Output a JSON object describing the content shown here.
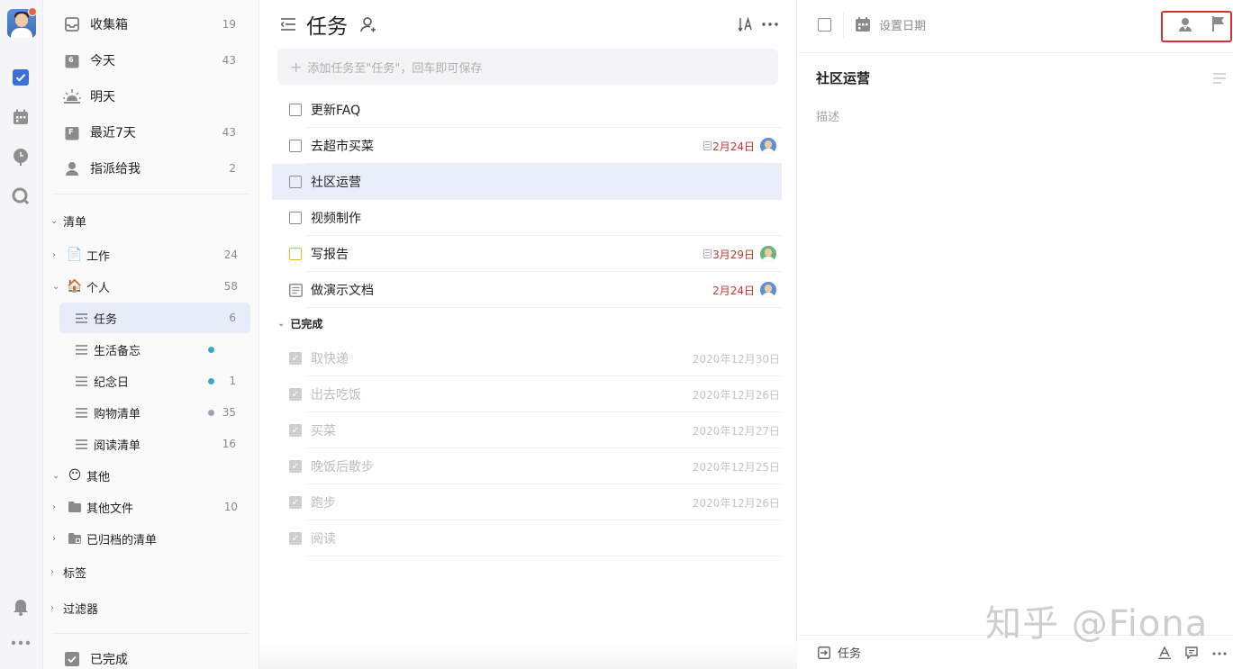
{
  "colors": {
    "accent": "#3b6fd8",
    "selected_bg": "#e9edf9",
    "date_red": "#c0392b",
    "highlight_box": "#d3302f"
  },
  "rail": {
    "items": [
      {
        "name": "tasks-icon"
      },
      {
        "name": "calendar-icon"
      },
      {
        "name": "pomodoro-icon"
      },
      {
        "name": "search-icon"
      },
      {
        "name": "bell-icon"
      },
      {
        "name": "more-icon"
      }
    ]
  },
  "smart_lists": [
    {
      "label": "收集箱",
      "count": "19",
      "icon": "inbox-icon"
    },
    {
      "label": "今天",
      "count": "43",
      "icon": "calendar-today-icon",
      "icon_text": "6"
    },
    {
      "label": "明天",
      "count": "",
      "icon": "sunrise-icon"
    },
    {
      "label": "最近7天",
      "count": "43",
      "icon": "calendar-week-icon",
      "icon_text": "F"
    },
    {
      "label": "指派给我",
      "count": "2",
      "icon": "assigned-icon"
    }
  ],
  "lists_section": {
    "label": "清单"
  },
  "folders": [
    {
      "label": "工作",
      "count": "24",
      "icon": "📄"
    },
    {
      "label": "个人",
      "count": "58",
      "icon": "🏠"
    }
  ],
  "personal_lists": [
    {
      "label": "任务",
      "count": "6",
      "dot": ""
    },
    {
      "label": "生活备忘",
      "count": "",
      "dot": "#3aa8c1"
    },
    {
      "label": "纪念日",
      "count": "1",
      "dot": "#3aa8c1"
    },
    {
      "label": "购物清单",
      "count": "35",
      "dot": "#9aa7b5"
    },
    {
      "label": "阅读清单",
      "count": "16",
      "dot": ""
    }
  ],
  "other_folder": {
    "label": "其他",
    "icon": "😶"
  },
  "other_items": [
    {
      "label": "其他文件",
      "count": "10"
    },
    {
      "label": "已归档的清单",
      "count": ""
    }
  ],
  "tags_section": {
    "label": "标签"
  },
  "filters_section": {
    "label": "过滤器"
  },
  "completed_section": {
    "label": "已完成"
  },
  "main": {
    "title": "任务",
    "add_placeholder": "添加任务至\"任务\"，回车即可保存",
    "tasks": [
      {
        "text": "更新FAQ",
        "date": "",
        "note": false,
        "avatar": "",
        "checkbox": "plain"
      },
      {
        "text": "去超市买菜",
        "date": "2月24日",
        "note": true,
        "avatar": "blue",
        "checkbox": "plain"
      },
      {
        "text": "社区运营",
        "date": "",
        "note": false,
        "avatar": "",
        "checkbox": "plain"
      },
      {
        "text": "视频制作",
        "date": "",
        "note": false,
        "avatar": "",
        "checkbox": "plain"
      },
      {
        "text": "写报告",
        "date": "3月29日",
        "note": true,
        "avatar": "green",
        "checkbox": "yellow"
      },
      {
        "text": "做演示文档",
        "date": "2月24日",
        "note": false,
        "avatar": "blue",
        "checkbox": "note"
      }
    ],
    "done_header": "已完成",
    "done_tasks": [
      {
        "text": "取快递",
        "date": "2020年12月30日"
      },
      {
        "text": "出去吃饭",
        "date": "2020年12月26日"
      },
      {
        "text": "买菜",
        "date": "2020年12月27日"
      },
      {
        "text": "晚饭后散步",
        "date": "2020年12月25日"
      },
      {
        "text": "跑步",
        "date": "2020年12月26日"
      },
      {
        "text": "阅读",
        "date": ""
      }
    ]
  },
  "detail": {
    "set_date": "设置日期",
    "title": "社区运营",
    "description_placeholder": "描述",
    "footer_list": "任务",
    "watermark": "知乎 @Fiona"
  }
}
